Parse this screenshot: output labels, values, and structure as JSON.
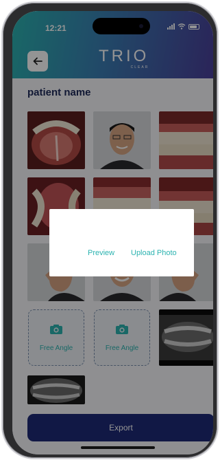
{
  "status_bar": {
    "time": "12:21"
  },
  "header": {
    "logo_text": "TRIO",
    "logo_subtext": "CLEAR"
  },
  "patient": {
    "name": "patient name"
  },
  "free_angle_tiles": [
    {
      "label": "Free Angle"
    },
    {
      "label": "Free Angle"
    }
  ],
  "export_button": {
    "label": "Export"
  },
  "dialog": {
    "preview_label": "Preview",
    "upload_label": "Upload Photo"
  },
  "colors": {
    "accent_teal": "#2bb3b0",
    "brand_navy": "#1e2a78",
    "header_gradient_start": "#2bb3b0",
    "header_gradient_end": "#4a3f9a"
  },
  "icons": [
    "back-arrow-icon",
    "camera-icon",
    "signal-icon",
    "wifi-icon",
    "battery-icon"
  ]
}
